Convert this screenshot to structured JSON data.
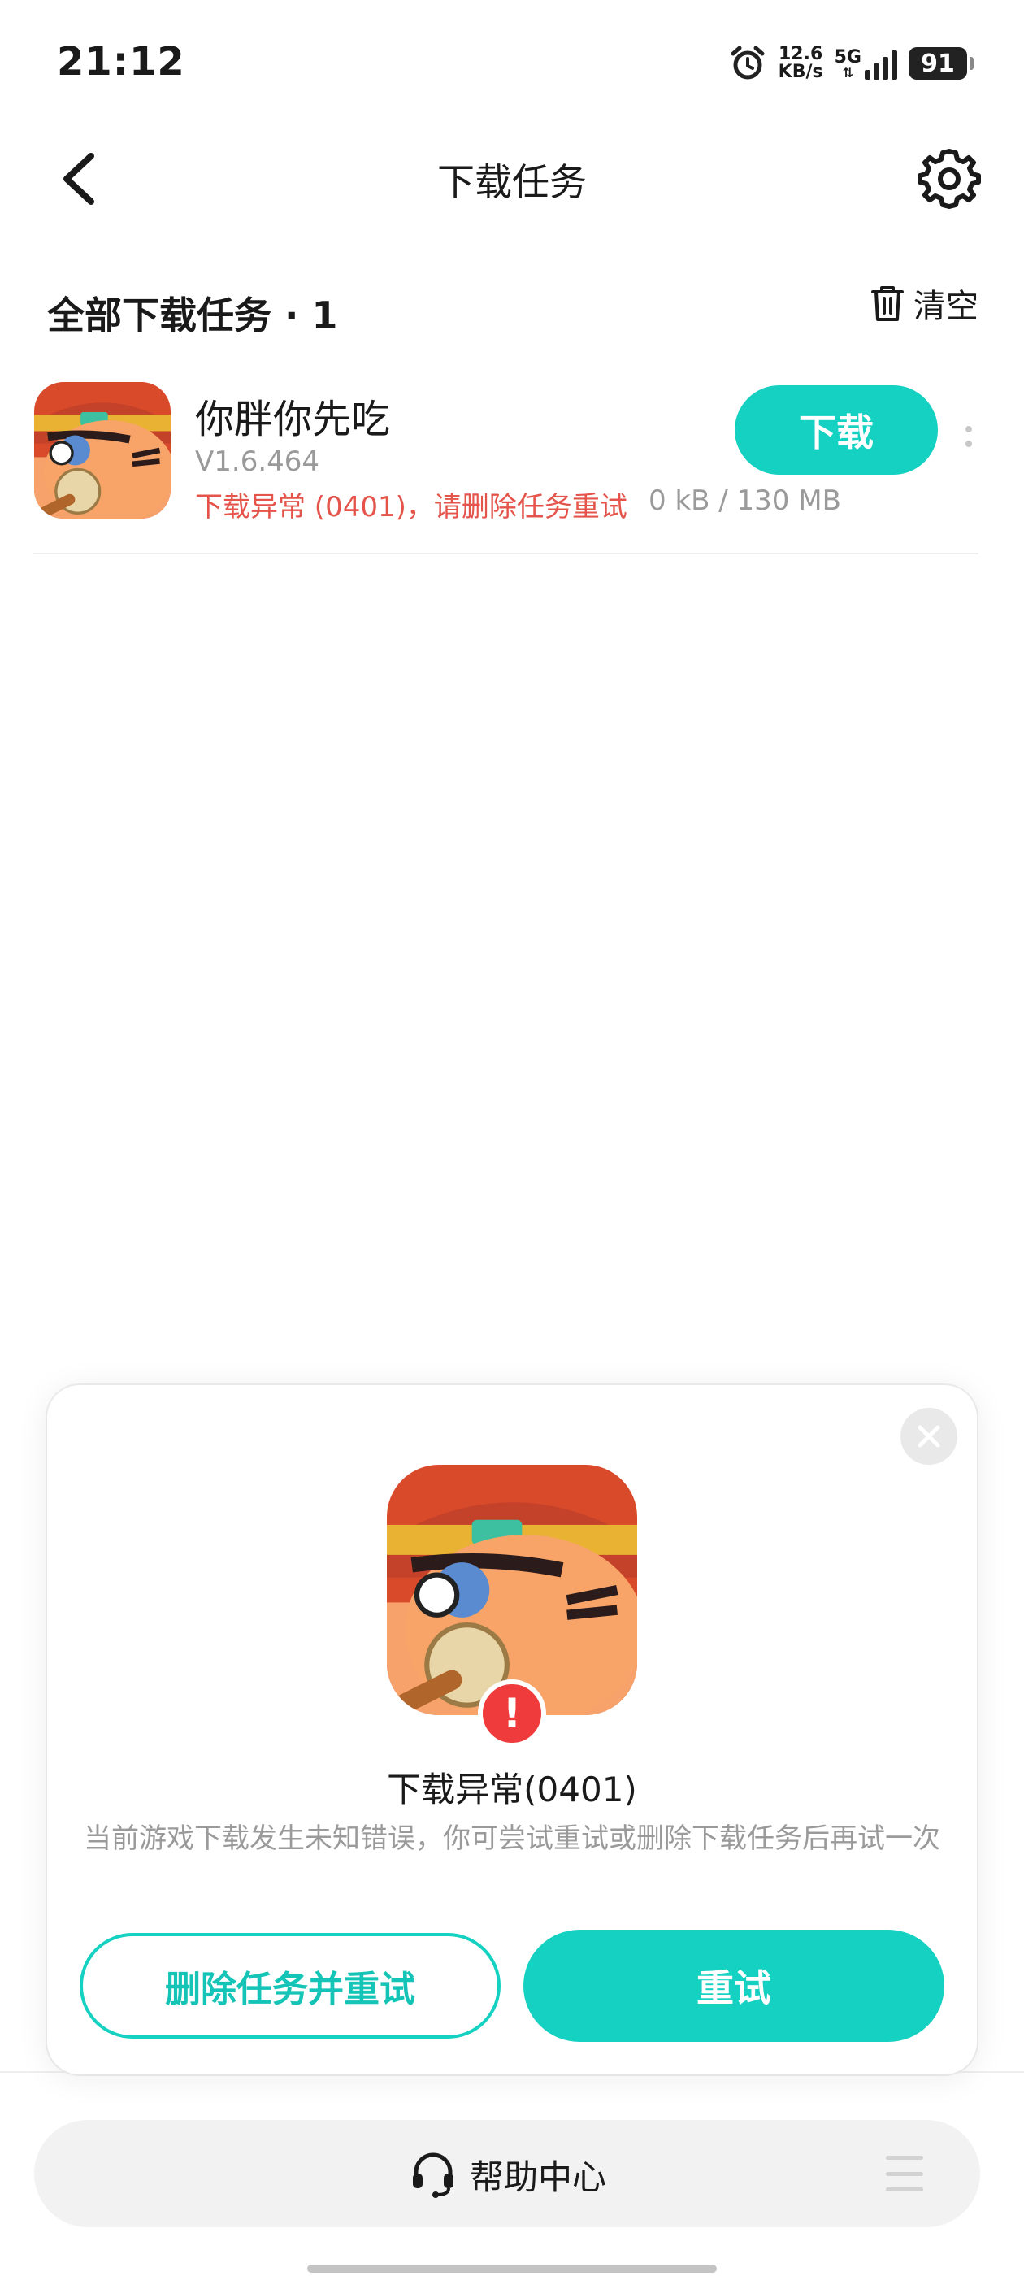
{
  "status_bar": {
    "time": "21:12",
    "net_speed_value": "12.6",
    "net_speed_unit": "KB/s",
    "network_type": "5G",
    "battery": "91",
    "icons": [
      "alarm-icon",
      "signal-icon",
      "battery-icon"
    ]
  },
  "header": {
    "title": "下载任务",
    "back_icon": "chevron-left-icon",
    "settings_icon": "gear-icon"
  },
  "section": {
    "title": "全部下载任务 · 1",
    "clear_label": "清空",
    "clear_icon": "trash-icon"
  },
  "tasks": [
    {
      "name": "你胖你先吃",
      "version": "V1.6.464",
      "error": "下载异常 (0401)，请删除任务重试",
      "size": "0 kB / 130 MB",
      "action_label": "下载"
    }
  ],
  "dialog": {
    "title": "下载异常(0401)",
    "description": "当前游戏下载发生未知错误，你可尝试重试或删除下载任务后再试一次",
    "delete_retry_label": "删除任务并重试",
    "retry_label": "重试",
    "badge": "!"
  },
  "help_bar": {
    "label": "帮助中心",
    "icon": "headset-icon"
  },
  "colors": {
    "accent": "#14d1c2",
    "error": "#e5544b",
    "badge": "#ef3b3b"
  }
}
